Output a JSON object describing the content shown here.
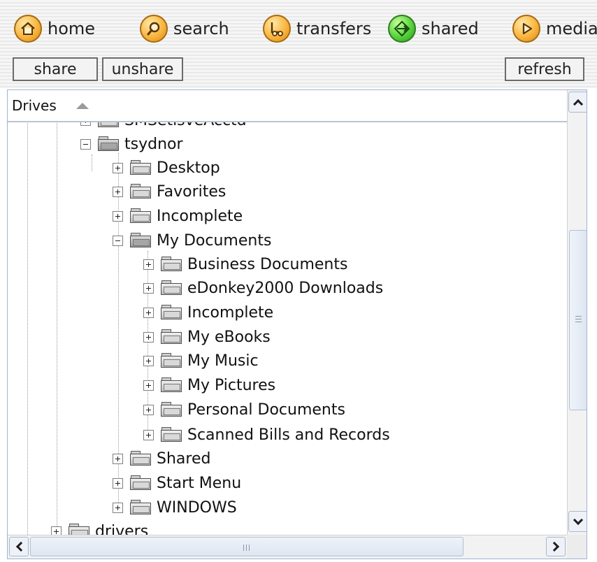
{
  "nav": {
    "items": [
      {
        "label": "home",
        "icon": "home-icon"
      },
      {
        "label": "search",
        "icon": "search-icon"
      },
      {
        "label": "transfers",
        "icon": "transfers-icon"
      },
      {
        "label": "shared",
        "icon": "shared-icon"
      },
      {
        "label": "media",
        "icon": "media-icon"
      }
    ]
  },
  "toolbar": {
    "share_label": "share",
    "unshare_label": "unshare",
    "refresh_label": "refresh"
  },
  "panel": {
    "header_label": "Drives"
  },
  "tree": {
    "items": [
      {
        "label": "SMSetisveAcctd",
        "depth": 1,
        "state": "collapsed"
      },
      {
        "label": "tsydnor",
        "depth": 1,
        "state": "expanded"
      },
      {
        "label": "Desktop",
        "depth": 2,
        "state": "collapsed"
      },
      {
        "label": "Favorites",
        "depth": 2,
        "state": "collapsed"
      },
      {
        "label": "Incomplete",
        "depth": 2,
        "state": "collapsed"
      },
      {
        "label": "My Documents",
        "depth": 2,
        "state": "expanded"
      },
      {
        "label": "Business Documents",
        "depth": 3,
        "state": "collapsed"
      },
      {
        "label": "eDonkey2000 Downloads",
        "depth": 3,
        "state": "collapsed"
      },
      {
        "label": "Incomplete",
        "depth": 3,
        "state": "collapsed"
      },
      {
        "label": "My eBooks",
        "depth": 3,
        "state": "collapsed"
      },
      {
        "label": "My Music",
        "depth": 3,
        "state": "collapsed"
      },
      {
        "label": "My Pictures",
        "depth": 3,
        "state": "collapsed"
      },
      {
        "label": "Personal Documents",
        "depth": 3,
        "state": "collapsed"
      },
      {
        "label": "Scanned Bills and Records",
        "depth": 3,
        "state": "collapsed"
      },
      {
        "label": "Shared",
        "depth": 2,
        "state": "collapsed"
      },
      {
        "label": "Start Menu",
        "depth": 2,
        "state": "collapsed"
      },
      {
        "label": "WINDOWS",
        "depth": 2,
        "state": "collapsed"
      },
      {
        "label": "drivers",
        "depth": 0,
        "state": "collapsed"
      }
    ]
  },
  "colors": {
    "nav_orange": "#f8b640",
    "nav_green": "#58d33c",
    "panel_border": "#9fb5d2"
  }
}
